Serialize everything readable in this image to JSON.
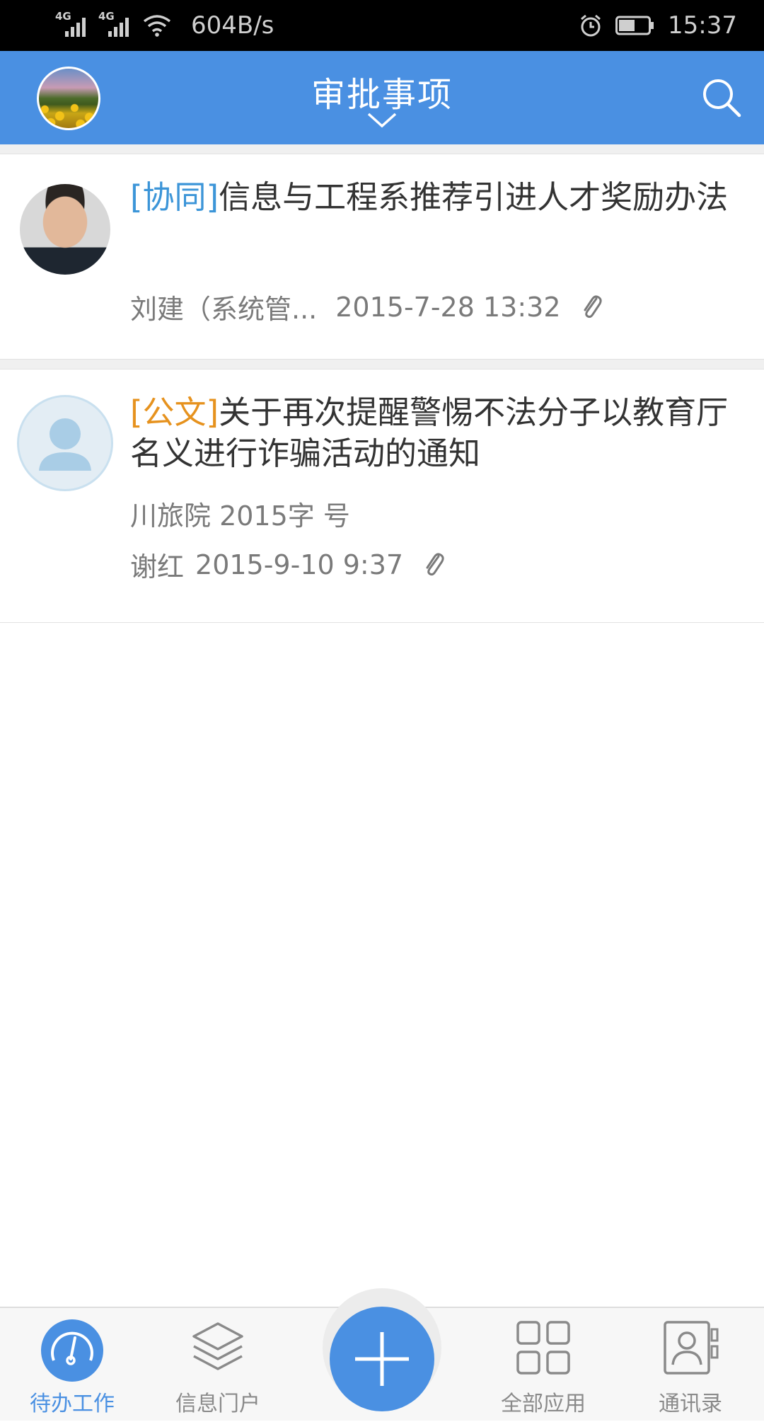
{
  "status_bar": {
    "net1": "4G",
    "net2": "4G",
    "speed": "604B/s",
    "time": "15:37"
  },
  "header": {
    "title": "审批事项"
  },
  "items": [
    {
      "tag": "[协同]",
      "title": "信息与工程系推荐引进人才奖励办法",
      "sender": "刘建（系统管...",
      "time": "2015-7-28 13:32"
    },
    {
      "tag": "[公文]",
      "title": "关于再次提醒警惕不法分子以教育厅名义进行诈骗活动的通知",
      "doc_no": "川旅院 2015字 号",
      "sender": "谢红",
      "time": "2015-9-10 9:37"
    }
  ],
  "tabbar": {
    "tabs": [
      {
        "label": "待办工作",
        "icon": "dashboard-icon",
        "active": true
      },
      {
        "label": "信息门户",
        "icon": "layers-icon",
        "active": false
      },
      {
        "label": "全部应用",
        "icon": "grid-icon",
        "active": false
      },
      {
        "label": "通讯录",
        "icon": "contacts-icon",
        "active": false
      }
    ],
    "fab_icon": "plus-icon"
  },
  "colors": {
    "primary": "#4a90e2",
    "tag_blue": "#3c95d8",
    "tag_orange": "#e6921e",
    "status_bar": "#000000"
  }
}
